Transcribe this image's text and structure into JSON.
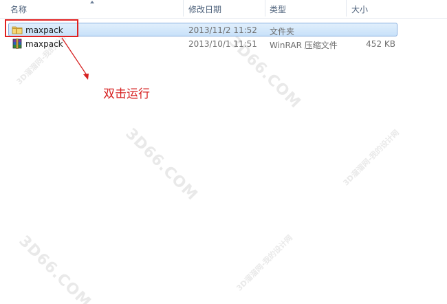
{
  "columns": {
    "name": "名称",
    "modified": "修改日期",
    "type": "类型",
    "size": "大小"
  },
  "files": [
    {
      "name": "maxpack",
      "modified": "2013/11/2 11:52",
      "type": "文件夹",
      "size": "",
      "icon": "folder-icon",
      "selected": true
    },
    {
      "name": "maxpack",
      "modified": "2013/10/1 11:51",
      "type": "WinRAR 压缩文件",
      "size": "452 KB",
      "icon": "winrar-archive-icon",
      "selected": false
    }
  ],
  "annotation": {
    "text": "双击运行",
    "color": "#d62020"
  },
  "watermark": {
    "site": "3D66.COM",
    "cn": "3D溜溜网-我的设计网"
  },
  "colors": {
    "selection": "#c8e1f9",
    "selection_border": "#84acdd",
    "header_text": "#4c607a",
    "highlight": "#e02020"
  }
}
